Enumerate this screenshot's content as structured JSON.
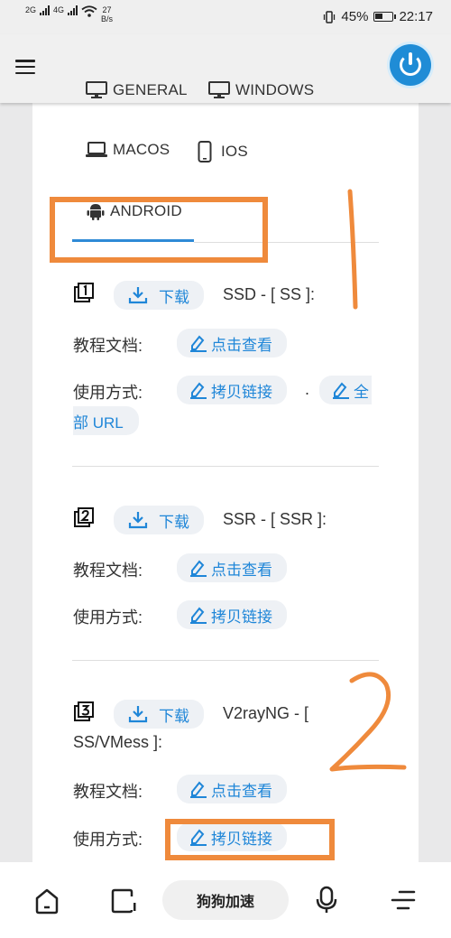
{
  "status_bar": {
    "signal1": "2G",
    "signal2": "4G",
    "net_speed": "27",
    "net_unit": "B/s",
    "battery": "45%",
    "time": "22:17"
  },
  "tabs": {
    "general": "GENERAL",
    "windows": "WINDOWS",
    "macos": "MACOS",
    "ios": "IOS",
    "android": "ANDROID"
  },
  "sections": [
    {
      "download_label": "下载",
      "title": "SSD - [ SS ]:",
      "tutorial_label": "教程文档:",
      "tutorial_btn": "点击查看",
      "usage_label": "使用方式:",
      "copy_btn": "拷贝链接",
      "separator": ".",
      "all_btn_part1": "全",
      "all_btn_part2": "部 URL"
    },
    {
      "download_label": "下载",
      "title": "SSR - [ SSR ]:",
      "tutorial_label": "教程文档:",
      "tutorial_btn": "点击查看",
      "usage_label": "使用方式:",
      "copy_btn": "拷贝链接"
    },
    {
      "download_label": "下载",
      "title_line1": "V2rayNG - [",
      "title_line2": "SS/VMess ]:",
      "tutorial_label": "教程文档:",
      "tutorial_btn": "点击查看",
      "usage_label": "使用方式:",
      "copy_btn": "拷贝链接"
    }
  ],
  "bottom_nav": {
    "search_label": "狗狗加速"
  },
  "colors": {
    "accent": "#1f86d8",
    "annotation": "#ef8a3c"
  }
}
